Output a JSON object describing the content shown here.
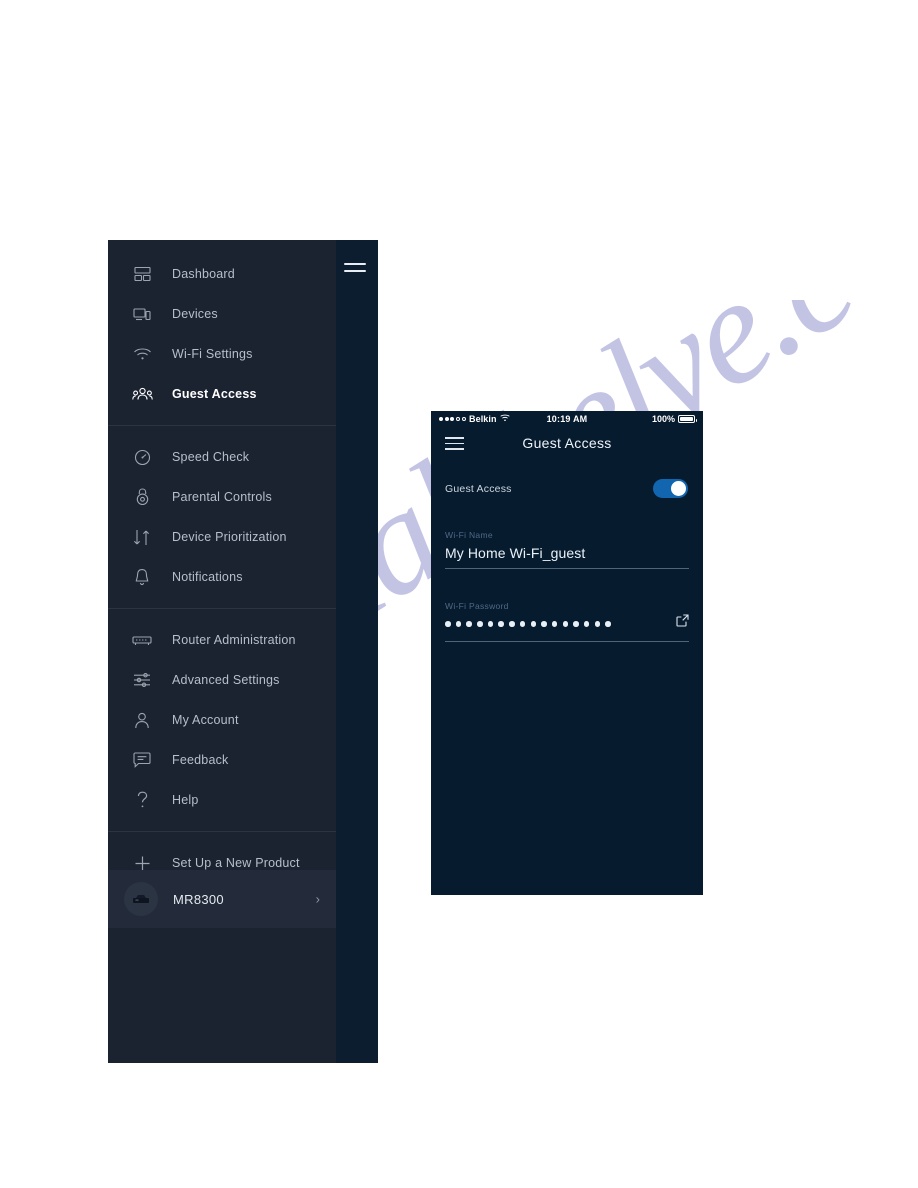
{
  "watermark": {
    "text": "manualshelve.com"
  },
  "sidebar": {
    "hamburger_icon": "hamburger-icon",
    "groups": [
      {
        "items": [
          {
            "label": "Dashboard",
            "icon": "dashboard-grid-icon",
            "active": false
          },
          {
            "label": "Devices",
            "icon": "devices-icon",
            "active": false
          },
          {
            "label": "Wi-Fi Settings",
            "icon": "wifi-icon",
            "active": false
          },
          {
            "label": "Guest Access",
            "icon": "people-group-icon",
            "active": true
          }
        ]
      },
      {
        "items": [
          {
            "label": "Speed Check",
            "icon": "speedometer-icon",
            "active": false
          },
          {
            "label": "Parental Controls",
            "icon": "lock-circle-icon",
            "active": false
          },
          {
            "label": "Device Prioritization",
            "icon": "up-down-arrows-icon",
            "active": false
          },
          {
            "label": "Notifications",
            "icon": "bell-icon",
            "active": false
          }
        ]
      },
      {
        "items": [
          {
            "label": "Router Administration",
            "icon": "router-icon",
            "active": false
          },
          {
            "label": "Advanced Settings",
            "icon": "sliders-icon",
            "active": false
          },
          {
            "label": "My Account",
            "icon": "person-icon",
            "active": false
          },
          {
            "label": "Feedback",
            "icon": "speech-bubble-icon",
            "active": false
          },
          {
            "label": "Help",
            "icon": "question-mark-icon",
            "active": false
          }
        ]
      },
      {
        "items": [
          {
            "label": "Set Up a New Product",
            "icon": "plus-icon",
            "active": false
          }
        ]
      }
    ],
    "device": {
      "name": "MR8300",
      "avatar_icon": "router-device-icon",
      "chevron_icon": "chevron-right-icon"
    }
  },
  "phone": {
    "status_bar": {
      "signal_icon": "signal-dots-icon",
      "carrier": "Belkin",
      "wifi_icon": "wifi-icon",
      "time": "10:19 AM",
      "battery_percent": "100%",
      "battery_icon": "battery-full-icon"
    },
    "header": {
      "menu_icon": "hamburger-icon",
      "title": "Guest Access"
    },
    "guest_toggle": {
      "label": "Guest Access",
      "state": "on",
      "accent_color": "#1266b0"
    },
    "wifi_name": {
      "label": "Wi-Fi Name",
      "value": "My Home Wi-Fi_guest"
    },
    "wifi_password": {
      "label": "Wi-Fi Password",
      "masked_dot_count": 16,
      "share_icon": "external-link-icon"
    }
  },
  "colors": {
    "sidebar_bg": "#1b2230",
    "sidebar_rail": "#0b1d2e",
    "phone_bg": "#071b2e",
    "accent": "#1266b0",
    "page_bg": "#ffffff"
  }
}
